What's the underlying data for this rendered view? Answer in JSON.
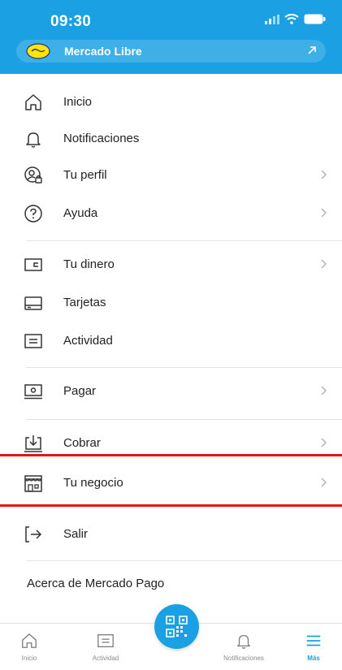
{
  "status_bar": {
    "time": "09:30"
  },
  "mercado_libre": {
    "label": "Mercado Libre"
  },
  "menu": {
    "inicio": "Inicio",
    "notificaciones": "Notificaciones",
    "tu_perfil": "Tu perfil",
    "ayuda": "Ayuda",
    "tu_dinero": "Tu dinero",
    "tarjetas": "Tarjetas",
    "actividad": "Actividad",
    "pagar": "Pagar",
    "cobrar": "Cobrar",
    "tu_negocio": "Tu negocio",
    "salir": "Salir",
    "acerca": "Acerca de Mercado Pago"
  },
  "tabbar": {
    "inicio": "Inicio",
    "actividad": "Actividad",
    "notificaciones": "Notificaciones",
    "mas": "Más"
  },
  "colors": {
    "brand": "#1aa0e3",
    "highlight": "#e8141b"
  },
  "icons": [
    "home-icon",
    "bell-icon",
    "profile-icon",
    "help-icon",
    "wallet-icon",
    "card-icon",
    "activity-icon",
    "pay-icon",
    "collect-icon",
    "store-icon",
    "logout-icon",
    "qr-icon",
    "menu-icon",
    "chevron-right-icon"
  ]
}
